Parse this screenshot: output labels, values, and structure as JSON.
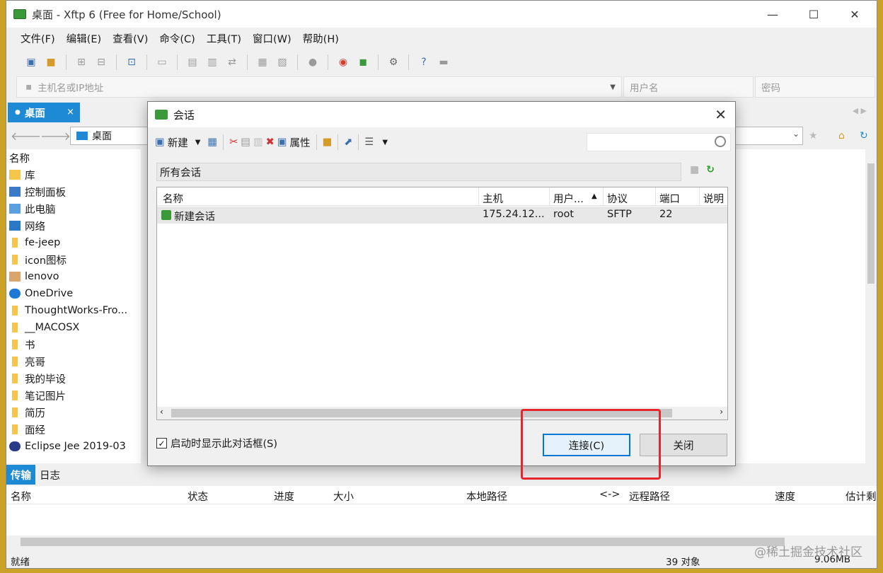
{
  "window": {
    "title": "桌面 - Xftp 6 (Free for Home/School)",
    "minimize": "—",
    "maximize": "☐",
    "close": "✕"
  },
  "menu": [
    "文件(F)",
    "编辑(E)",
    "查看(V)",
    "命令(C)",
    "工具(T)",
    "窗口(W)",
    "帮助(H)"
  ],
  "address": {
    "host_placeholder": "主机名或IP地址",
    "user_placeholder": "用户名",
    "password_placeholder": "密码"
  },
  "tab": {
    "label": "桌面",
    "close": "×"
  },
  "nav": {
    "path": "桌面"
  },
  "local": {
    "header": "名称",
    "items": [
      "库",
      "控制面板",
      "此电脑",
      "网络",
      "fe-jeep",
      "icon图标",
      "lenovo",
      "OneDrive",
      "ThoughtWorks-Fro...",
      "__MACOSX",
      "书",
      "亮哥",
      "我的毕设",
      "笔记图片",
      "简历",
      "面经",
      "Eclipse Jee 2019-03"
    ]
  },
  "bottom_tabs": [
    "传输",
    "日志"
  ],
  "transfer_columns": [
    "名称",
    "状态",
    "进度",
    "大小",
    "本地路径",
    "<->",
    "远程路径",
    "速度",
    "估计剩"
  ],
  "status": {
    "left": "就绪",
    "count": "39 对象",
    "size": "9.06MB"
  },
  "dialog": {
    "title": "会话",
    "toolbar": {
      "new": "新建",
      "properties": "属性"
    },
    "folder": "所有会话",
    "columns": [
      "名称",
      "主机",
      "用户...",
      "协议",
      "端口",
      "说明"
    ],
    "rows": [
      {
        "name": "新建会话",
        "host": "175.24.12...",
        "user": "root",
        "protocol": "SFTP",
        "port": "22",
        "desc": ""
      }
    ],
    "checkbox": {
      "label": "启动时显示此对话框(S)",
      "checked": true
    },
    "connect": "连接(C)",
    "close": "关闭"
  },
  "watermark": "@稀土掘金技术社区",
  "colors": {
    "accent": "#1e8ad6",
    "highlight": "#e5262b"
  }
}
